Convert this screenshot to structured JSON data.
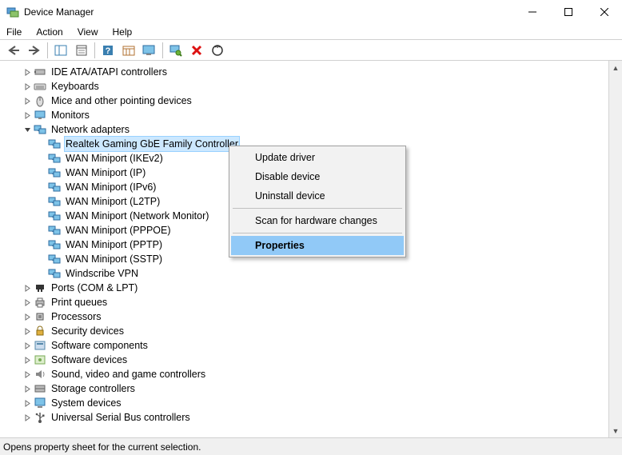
{
  "window": {
    "title": "Device Manager"
  },
  "menubar": [
    "File",
    "Action",
    "View",
    "Help"
  ],
  "toolbar_icons": [
    "back",
    "forward",
    "|",
    "show-hide-tree",
    "properties-sheet",
    "|",
    "help",
    "refresh-period",
    "monitor",
    "|",
    "scan",
    "uninstall",
    "update-driver"
  ],
  "tree": [
    {
      "depth": 1,
      "expander": ">",
      "icon": "ide",
      "label": "IDE ATA/ATAPI controllers"
    },
    {
      "depth": 1,
      "expander": ">",
      "icon": "keyboard",
      "label": "Keyboards"
    },
    {
      "depth": 1,
      "expander": ">",
      "icon": "mouse",
      "label": "Mice and other pointing devices"
    },
    {
      "depth": 1,
      "expander": ">",
      "icon": "monitor",
      "label": "Monitors"
    },
    {
      "depth": 1,
      "expander": "v",
      "icon": "net",
      "label": "Network adapters"
    },
    {
      "depth": 2,
      "expander": "",
      "icon": "net",
      "label": "Realtek Gaming GbE Family Controller",
      "selected": true
    },
    {
      "depth": 2,
      "expander": "",
      "icon": "net",
      "label": "WAN Miniport (IKEv2)"
    },
    {
      "depth": 2,
      "expander": "",
      "icon": "net",
      "label": "WAN Miniport (IP)"
    },
    {
      "depth": 2,
      "expander": "",
      "icon": "net",
      "label": "WAN Miniport (IPv6)"
    },
    {
      "depth": 2,
      "expander": "",
      "icon": "net",
      "label": "WAN Miniport (L2TP)"
    },
    {
      "depth": 2,
      "expander": "",
      "icon": "net",
      "label": "WAN Miniport (Network Monitor)"
    },
    {
      "depth": 2,
      "expander": "",
      "icon": "net",
      "label": "WAN Miniport (PPPOE)"
    },
    {
      "depth": 2,
      "expander": "",
      "icon": "net",
      "label": "WAN Miniport (PPTP)"
    },
    {
      "depth": 2,
      "expander": "",
      "icon": "net",
      "label": "WAN Miniport (SSTP)"
    },
    {
      "depth": 2,
      "expander": "",
      "icon": "net",
      "label": "Windscribe VPN"
    },
    {
      "depth": 1,
      "expander": ">",
      "icon": "ports",
      "label": "Ports (COM & LPT)"
    },
    {
      "depth": 1,
      "expander": ">",
      "icon": "print",
      "label": "Print queues"
    },
    {
      "depth": 1,
      "expander": ">",
      "icon": "cpu",
      "label": "Processors"
    },
    {
      "depth": 1,
      "expander": ">",
      "icon": "security",
      "label": "Security devices"
    },
    {
      "depth": 1,
      "expander": ">",
      "icon": "swcomp",
      "label": "Software components"
    },
    {
      "depth": 1,
      "expander": ">",
      "icon": "swdev",
      "label": "Software devices"
    },
    {
      "depth": 1,
      "expander": ">",
      "icon": "sound",
      "label": "Sound, video and game controllers"
    },
    {
      "depth": 1,
      "expander": ">",
      "icon": "storage",
      "label": "Storage controllers"
    },
    {
      "depth": 1,
      "expander": ">",
      "icon": "system",
      "label": "System devices"
    },
    {
      "depth": 1,
      "expander": ">",
      "icon": "usb",
      "label": "Universal Serial Bus controllers"
    }
  ],
  "context_menu": {
    "items": [
      {
        "label": "Update driver"
      },
      {
        "label": "Disable device"
      },
      {
        "label": "Uninstall device"
      },
      {
        "sep": true
      },
      {
        "label": "Scan for hardware changes"
      },
      {
        "sep": true
      },
      {
        "label": "Properties",
        "selected": true
      }
    ]
  },
  "statusbar": "Opens property sheet for the current selection."
}
